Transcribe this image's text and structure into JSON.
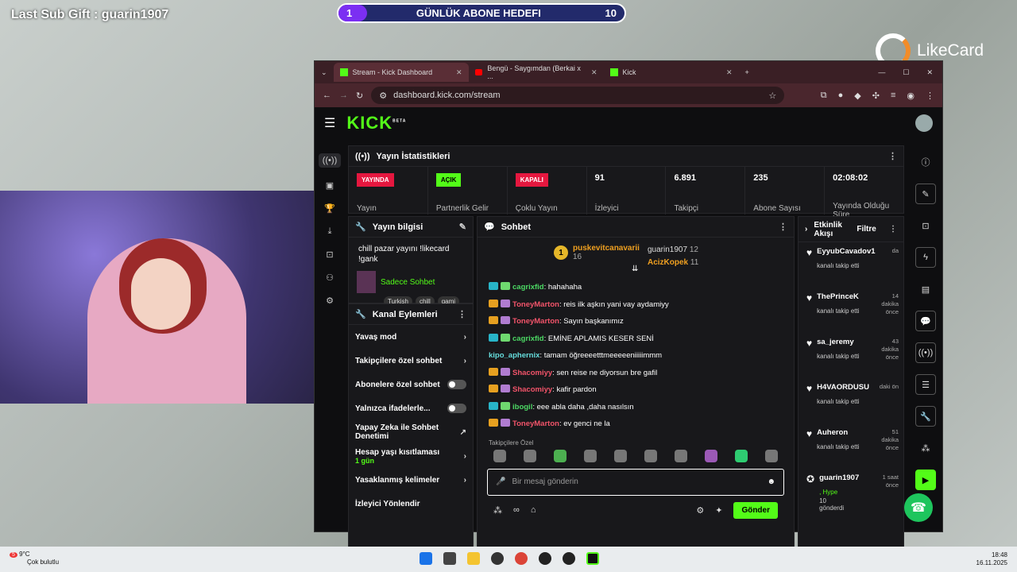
{
  "overlay": {
    "last_sub": "Last Sub Gift : guarin1907",
    "goal": {
      "current": "1",
      "title": "GÜNLÜK ABONE HEDEFI",
      "target": "10",
      "progress": 0.1
    },
    "brand": "LikeCard"
  },
  "browser": {
    "tabs": [
      {
        "label": "Stream - Kick Dashboard",
        "icon": "kick-icon"
      },
      {
        "label": "Bengü - Saygımdan (Berkai x ...",
        "icon": "youtube-icon"
      },
      {
        "label": "Kick",
        "icon": "kick-icon"
      }
    ],
    "url": "dashboard.kick.com/stream"
  },
  "kick": {
    "logo": "KICK",
    "logo_sup": "BETA",
    "stats": {
      "title": "Yayın İstatistikleri",
      "items": [
        {
          "badge": "YAYINDA",
          "badge_color": "#e5173f",
          "label": "Yayın"
        },
        {
          "badge": "AÇIK",
          "badge_color": "#53fc18",
          "label": "Partnerlik Gelir"
        },
        {
          "badge": "KAPALI",
          "badge_color": "#e5173f",
          "label": "Çoklu Yayın"
        },
        {
          "value": "91",
          "label": "İzleyici"
        },
        {
          "value": "6.891",
          "label": "Takipçi"
        },
        {
          "value": "235",
          "label": "Abone Sayısı"
        },
        {
          "value": "02:08:02",
          "label": "Yayında Olduğu Süre"
        }
      ]
    },
    "stream_info": {
      "title": "Yayın bilgisi",
      "stream_title": "chill pazar yayını !likecard !gank",
      "category": "Sadece Sohbet",
      "tags": [
        "Turkish",
        "chill",
        "gami"
      ]
    },
    "channel_actions": {
      "title": "Kanal Eylemleri",
      "items": [
        {
          "label": "Yavaş mod",
          "type": "chevron"
        },
        {
          "label": "Takipçilere özel sohbet",
          "type": "chevron"
        },
        {
          "label": "Abonelere özel sohbet",
          "type": "toggle"
        },
        {
          "label": "Yalnızca ifadelerle...",
          "type": "toggle"
        },
        {
          "label": "Yapay Zeka ile Sohbet Denetimi",
          "type": "external"
        },
        {
          "label": "Hesap yaşı kısıtlaması",
          "sub": "1 gün",
          "type": "chevron"
        },
        {
          "label": "Yasaklanmış kelimeler",
          "type": "chevron"
        },
        {
          "label": "İzleyici Yönlendir",
          "type": "none"
        }
      ]
    },
    "chat": {
      "title": "Sohbet",
      "leaderboard": {
        "first": {
          "name": "puskevitcanavarii",
          "count": "16"
        },
        "second": {
          "name": "guarin1907",
          "count": "12"
        },
        "third": {
          "name": "AcizKopek",
          "count": "11"
        }
      },
      "messages": [
        {
          "user": "cagrixfid",
          "color": "green",
          "text": ": hahahaha"
        },
        {
          "user": "ToneyMarton",
          "color": "red",
          "text": ": reis ilk aşkın yani vay aydamiyy"
        },
        {
          "user": "ToneyMarton",
          "color": "red",
          "text": ": Sayın başkanımız"
        },
        {
          "user": "cagrixfid",
          "color": "green",
          "text": ": EMİNE APLAMIS KESER SENİ"
        },
        {
          "user": "kipo_aphernix",
          "color": "teal",
          "text": ": tamam öğreeeetttmeeeeeniiiiimmm"
        },
        {
          "user": "Shacomiyy",
          "color": "red",
          "text": ": sen reise ne diyorsun bre gafil"
        },
        {
          "user": "Shacomiyy",
          "color": "red",
          "text": ": kafir pardon"
        },
        {
          "user": "ibogil",
          "color": "green",
          "text": ": eee abla daha ,daha nasılsın"
        },
        {
          "user": "ToneyMarton",
          "color": "red",
          "text": ": ev genci ne la"
        }
      ],
      "emotes_label": "Takipçilere Özel",
      "input_placeholder": "Bir mesaj gönderin",
      "send_label": "Gönder"
    },
    "activity": {
      "title": "Etkinlik Akışı",
      "filter": "Filtre",
      "items": [
        {
          "user": "EyyubCavadov1",
          "time": "da",
          "action": "kanalı takip etti"
        },
        {
          "user": "ThePrinceK",
          "time": "14 dakika önce",
          "action": "kanalı takip etti"
        },
        {
          "user": "sa_jeremy",
          "time": "43 dakika önce",
          "action": "kanalı takip etti"
        },
        {
          "user": "H4VAORDUSU",
          "time": "daki ön",
          "action": "kanalı takip etti"
        },
        {
          "user": "Auheron",
          "time": "51 dakika önce",
          "action": "kanalı takip etti"
        },
        {
          "user": "guarin1907",
          "time": "1 saat önce",
          "action": ", Hype",
          "extra": "10",
          "extra2": "gönderdi"
        }
      ]
    }
  },
  "taskbar": {
    "weather_temp": "9°C",
    "weather_desc": "Çok bulutlu",
    "weather_badge": "5",
    "time": "18:48",
    "date": "16.11.2025"
  }
}
